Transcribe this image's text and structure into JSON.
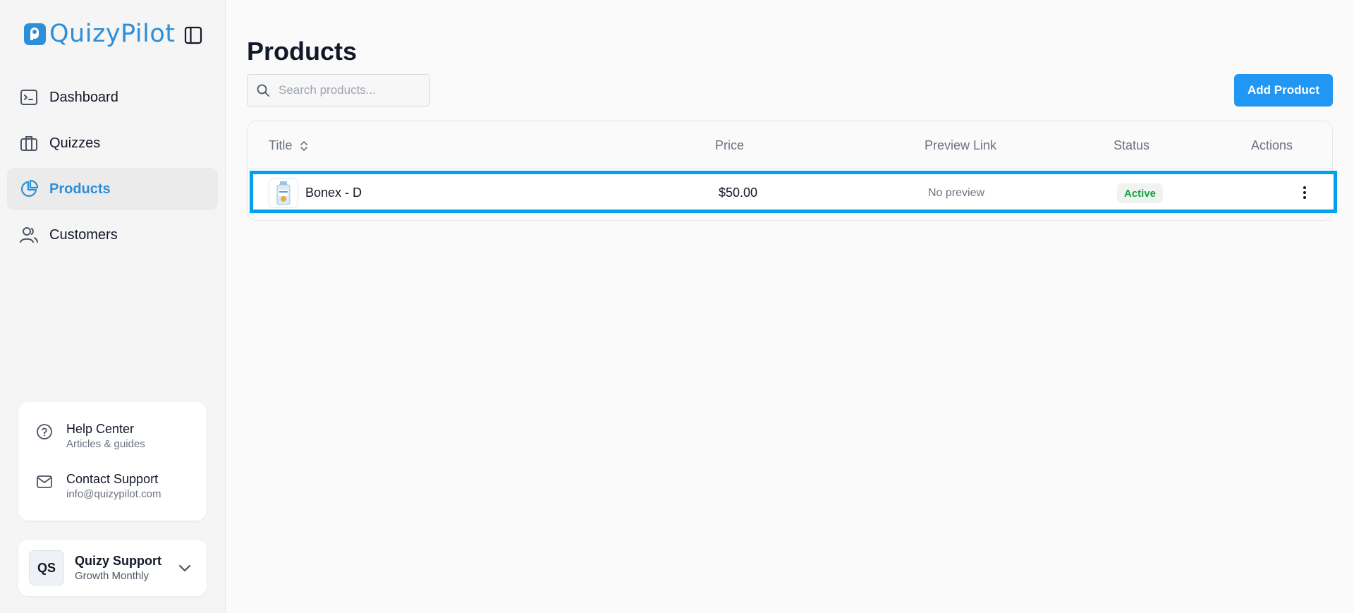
{
  "brand": {
    "name": "QuizyPilot",
    "accent": "#2d8fd8"
  },
  "sidebar": {
    "items": [
      {
        "label": "Dashboard",
        "icon": "terminal-icon",
        "active": false
      },
      {
        "label": "Quizzes",
        "icon": "briefcase-icon",
        "active": false
      },
      {
        "label": "Products",
        "icon": "pie-chart-icon",
        "active": true
      },
      {
        "label": "Customers",
        "icon": "users-icon",
        "active": false
      }
    ],
    "help": [
      {
        "title": "Help Center",
        "subtitle": "Articles & guides",
        "icon": "help-circle-icon"
      },
      {
        "title": "Contact Support",
        "subtitle": "info@quizypilot.com",
        "icon": "mail-icon"
      }
    ],
    "user": {
      "initials": "QS",
      "name": "Quizy Support",
      "plan": "Growth Monthly"
    }
  },
  "main": {
    "title": "Products",
    "search": {
      "placeholder": "Search products...",
      "value": ""
    },
    "add_button": "Add Product",
    "table": {
      "columns": [
        "Title",
        "Price",
        "Preview Link",
        "Status",
        "Actions"
      ],
      "rows": [
        {
          "title": "Bonex - D",
          "price": "$50.00",
          "preview": "No preview",
          "status": "Active"
        }
      ]
    }
  },
  "colors": {
    "primary_button": "#2196f3",
    "status_active": "#16a34a",
    "row_highlight": "#00a2ee"
  }
}
